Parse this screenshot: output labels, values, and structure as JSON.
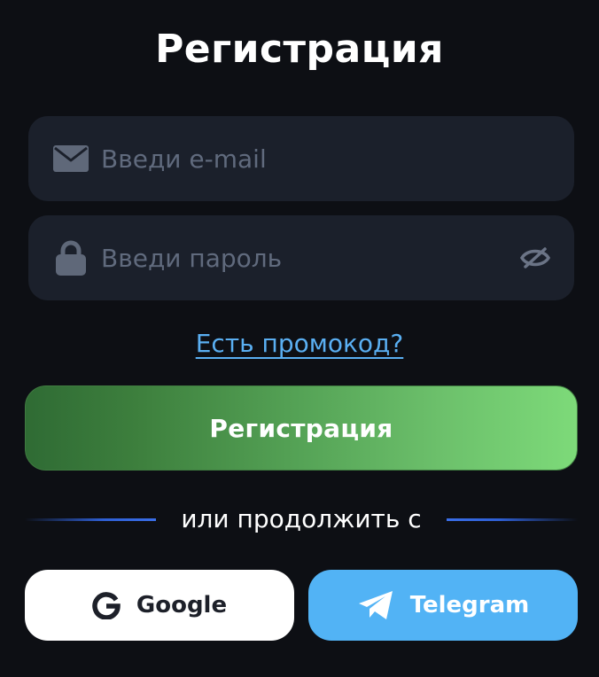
{
  "title": "Регистрация",
  "email_field": {
    "icon": "mail-icon",
    "placeholder": "Введи e-mail",
    "value": ""
  },
  "password_field": {
    "icon": "lock-icon",
    "placeholder": "Введи пароль",
    "value": "",
    "toggle_icon": "eye-off-icon"
  },
  "promo_link": "Есть промокод?",
  "register_button": "Регистрация",
  "divider_text": "или продолжить с",
  "social": {
    "google": {
      "label": "Google",
      "icon": "google-icon"
    },
    "telegram": {
      "label": "Telegram",
      "icon": "telegram-icon"
    }
  },
  "colors": {
    "background": "#0d0f14",
    "field_background": "#1b202b",
    "placeholder": "#606a7d",
    "link": "#5aaff2",
    "button_gradient_start": "#2f6b34",
    "button_gradient_end": "#7dda79",
    "divider_line": "#3a6ee8",
    "google_bg": "#ffffff",
    "telegram_bg": "#52b3f5"
  }
}
